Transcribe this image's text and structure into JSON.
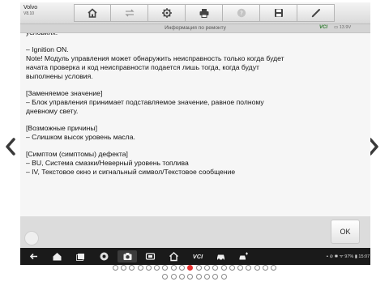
{
  "vehicle": {
    "make": "Volvo",
    "version": "V8.10"
  },
  "toolbar": {
    "icons": [
      "home-icon",
      "vehicle-swap-icon",
      "settings-icon",
      "print-icon",
      "help-icon",
      "save-icon",
      "pen-icon"
    ]
  },
  "titlebar": {
    "title": "Информация по ремонту",
    "vci": "VCI",
    "battery": "13.9V"
  },
  "content": {
    "lines": [
      "условиях.",
      "",
      "–   Ignition ON.",
      "Note! Модуль управления может обнаружить неисправность только когда будет",
      "начата проверка и код неисправности подается лишь тогда, когда будут",
      "выполнены условия.",
      "",
      "[Заменяемое значение]",
      "–   Блок управления принимает подставляемое значение, равное полному",
      "дневному свету.",
      "",
      "[Возможные причины]",
      "–   Слишком высок уровень масла.",
      "",
      "[Симптом (симптомы) дефекта]",
      "–   BU, Система смазки/Неверный уровень топлива",
      "–   IV, Текстовое окно и сигнальный символ/Текстовое сообщение"
    ]
  },
  "actions": {
    "ok_label": "OK"
  },
  "sysbar": {
    "icons": [
      "back-icon",
      "home-icon",
      "recent-apps-icon",
      "chrome-icon",
      "camera-icon",
      "screen-record-icon",
      "home-outline-icon",
      "vci-icon",
      "car-icon",
      "car-connect-icon"
    ],
    "vci_text": "VCI",
    "status": "▪ ⊘ ✱ ᯤ 97% ▮ 15:07"
  },
  "pagination": {
    "total": 28,
    "active_index": 9
  },
  "colors": {
    "accent_dot": "#e53030",
    "vci_green": "#2b7a2b",
    "sysbar_bg": "#1a1a1a"
  }
}
